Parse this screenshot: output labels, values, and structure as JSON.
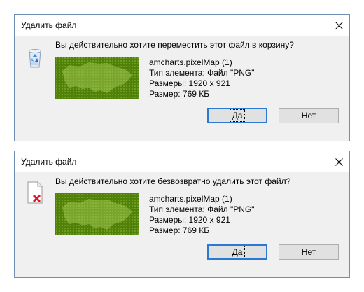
{
  "dialogs": [
    {
      "title": "Удалить файл",
      "icon": "recycle-bin-icon",
      "question": "Вы действительно хотите переместить этот файл в корзину?",
      "file_name": "amcharts.pixelMap (1)",
      "file_type": "Тип элемента: Файл \"PNG\"",
      "dimensions": "Размеры: 1920 x 921",
      "size": "Размер: 769 КБ",
      "yes_label": "Да",
      "no_label": "Нет"
    },
    {
      "title": "Удалить файл",
      "icon": "file-delete-icon",
      "question": "Вы действительно хотите безвозвратно удалить этот файл?",
      "file_name": "amcharts.pixelMap (1)",
      "file_type": "Тип элемента: Файл \"PNG\"",
      "dimensions": "Размеры: 1920 x 921",
      "size": "Размер: 769 КБ",
      "yes_label": "Да",
      "no_label": "Нет"
    }
  ],
  "colors": {
    "dialog_bg": "#f0f0f0",
    "border": "#6c8fb3",
    "default_button_border": "#2a7ad5",
    "thumbnail_green": "#52810a",
    "delete_x_red": "#e81123"
  }
}
